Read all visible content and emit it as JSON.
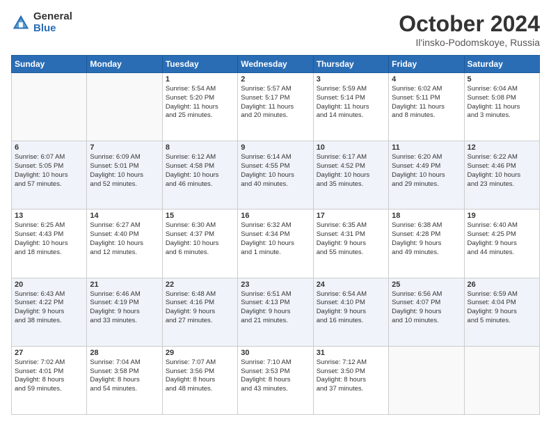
{
  "logo": {
    "general": "General",
    "blue": "Blue"
  },
  "title": "October 2024",
  "location": "Il'insko-Podomskoye, Russia",
  "days_header": [
    "Sunday",
    "Monday",
    "Tuesday",
    "Wednesday",
    "Thursday",
    "Friday",
    "Saturday"
  ],
  "weeks": [
    [
      {
        "day": "",
        "info": ""
      },
      {
        "day": "",
        "info": ""
      },
      {
        "day": "1",
        "info": "Sunrise: 5:54 AM\nSunset: 5:20 PM\nDaylight: 11 hours\nand 25 minutes."
      },
      {
        "day": "2",
        "info": "Sunrise: 5:57 AM\nSunset: 5:17 PM\nDaylight: 11 hours\nand 20 minutes."
      },
      {
        "day": "3",
        "info": "Sunrise: 5:59 AM\nSunset: 5:14 PM\nDaylight: 11 hours\nand 14 minutes."
      },
      {
        "day": "4",
        "info": "Sunrise: 6:02 AM\nSunset: 5:11 PM\nDaylight: 11 hours\nand 8 minutes."
      },
      {
        "day": "5",
        "info": "Sunrise: 6:04 AM\nSunset: 5:08 PM\nDaylight: 11 hours\nand 3 minutes."
      }
    ],
    [
      {
        "day": "6",
        "info": "Sunrise: 6:07 AM\nSunset: 5:05 PM\nDaylight: 10 hours\nand 57 minutes."
      },
      {
        "day": "7",
        "info": "Sunrise: 6:09 AM\nSunset: 5:01 PM\nDaylight: 10 hours\nand 52 minutes."
      },
      {
        "day": "8",
        "info": "Sunrise: 6:12 AM\nSunset: 4:58 PM\nDaylight: 10 hours\nand 46 minutes."
      },
      {
        "day": "9",
        "info": "Sunrise: 6:14 AM\nSunset: 4:55 PM\nDaylight: 10 hours\nand 40 minutes."
      },
      {
        "day": "10",
        "info": "Sunrise: 6:17 AM\nSunset: 4:52 PM\nDaylight: 10 hours\nand 35 minutes."
      },
      {
        "day": "11",
        "info": "Sunrise: 6:20 AM\nSunset: 4:49 PM\nDaylight: 10 hours\nand 29 minutes."
      },
      {
        "day": "12",
        "info": "Sunrise: 6:22 AM\nSunset: 4:46 PM\nDaylight: 10 hours\nand 23 minutes."
      }
    ],
    [
      {
        "day": "13",
        "info": "Sunrise: 6:25 AM\nSunset: 4:43 PM\nDaylight: 10 hours\nand 18 minutes."
      },
      {
        "day": "14",
        "info": "Sunrise: 6:27 AM\nSunset: 4:40 PM\nDaylight: 10 hours\nand 12 minutes."
      },
      {
        "day": "15",
        "info": "Sunrise: 6:30 AM\nSunset: 4:37 PM\nDaylight: 10 hours\nand 6 minutes."
      },
      {
        "day": "16",
        "info": "Sunrise: 6:32 AM\nSunset: 4:34 PM\nDaylight: 10 hours\nand 1 minute."
      },
      {
        "day": "17",
        "info": "Sunrise: 6:35 AM\nSunset: 4:31 PM\nDaylight: 9 hours\nand 55 minutes."
      },
      {
        "day": "18",
        "info": "Sunrise: 6:38 AM\nSunset: 4:28 PM\nDaylight: 9 hours\nand 49 minutes."
      },
      {
        "day": "19",
        "info": "Sunrise: 6:40 AM\nSunset: 4:25 PM\nDaylight: 9 hours\nand 44 minutes."
      }
    ],
    [
      {
        "day": "20",
        "info": "Sunrise: 6:43 AM\nSunset: 4:22 PM\nDaylight: 9 hours\nand 38 minutes."
      },
      {
        "day": "21",
        "info": "Sunrise: 6:46 AM\nSunset: 4:19 PM\nDaylight: 9 hours\nand 33 minutes."
      },
      {
        "day": "22",
        "info": "Sunrise: 6:48 AM\nSunset: 4:16 PM\nDaylight: 9 hours\nand 27 minutes."
      },
      {
        "day": "23",
        "info": "Sunrise: 6:51 AM\nSunset: 4:13 PM\nDaylight: 9 hours\nand 21 minutes."
      },
      {
        "day": "24",
        "info": "Sunrise: 6:54 AM\nSunset: 4:10 PM\nDaylight: 9 hours\nand 16 minutes."
      },
      {
        "day": "25",
        "info": "Sunrise: 6:56 AM\nSunset: 4:07 PM\nDaylight: 9 hours\nand 10 minutes."
      },
      {
        "day": "26",
        "info": "Sunrise: 6:59 AM\nSunset: 4:04 PM\nDaylight: 9 hours\nand 5 minutes."
      }
    ],
    [
      {
        "day": "27",
        "info": "Sunrise: 7:02 AM\nSunset: 4:01 PM\nDaylight: 8 hours\nand 59 minutes."
      },
      {
        "day": "28",
        "info": "Sunrise: 7:04 AM\nSunset: 3:58 PM\nDaylight: 8 hours\nand 54 minutes."
      },
      {
        "day": "29",
        "info": "Sunrise: 7:07 AM\nSunset: 3:56 PM\nDaylight: 8 hours\nand 48 minutes."
      },
      {
        "day": "30",
        "info": "Sunrise: 7:10 AM\nSunset: 3:53 PM\nDaylight: 8 hours\nand 43 minutes."
      },
      {
        "day": "31",
        "info": "Sunrise: 7:12 AM\nSunset: 3:50 PM\nDaylight: 8 hours\nand 37 minutes."
      },
      {
        "day": "",
        "info": ""
      },
      {
        "day": "",
        "info": ""
      }
    ]
  ]
}
